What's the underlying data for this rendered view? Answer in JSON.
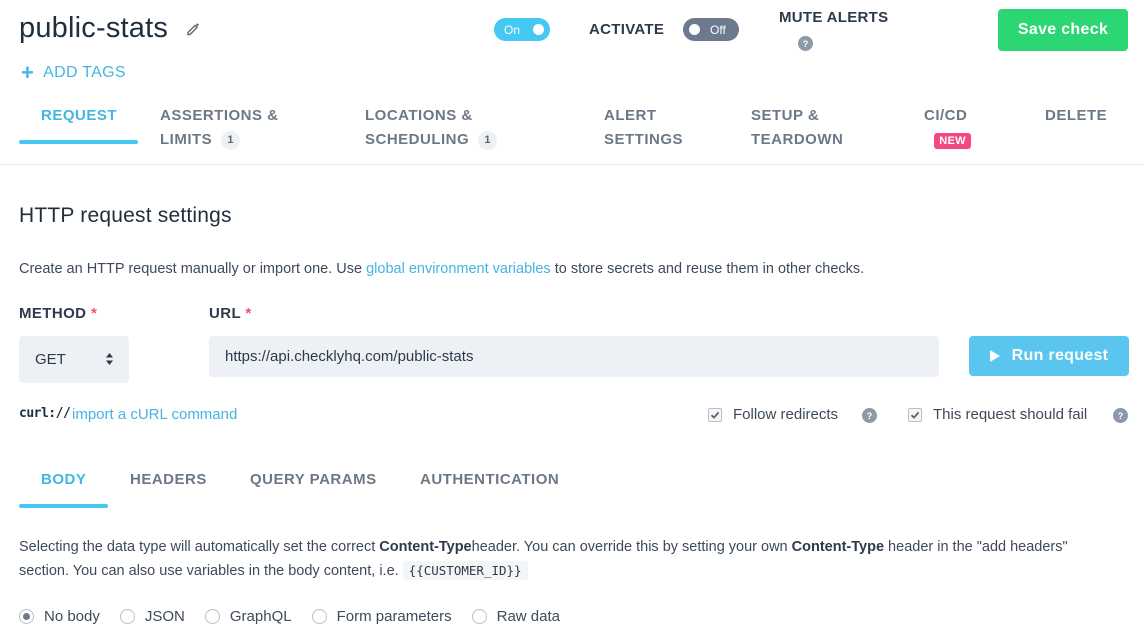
{
  "header": {
    "title": "public-stats",
    "toggle_on_label": "On",
    "activate_label": "ACTIVATE",
    "toggle_off_label": "Off",
    "mute_alerts_label": "MUTE ALERTS",
    "help_glyph": "?",
    "save_label": "Save check",
    "add_tags_label": "ADD TAGS",
    "add_tags_glyph": "+"
  },
  "tabs": [
    {
      "line1": "REQUEST",
      "line2": "",
      "count": ""
    },
    {
      "line1": "ASSERTIONS &",
      "line2": "LIMITS",
      "count": "1"
    },
    {
      "line1": "LOCATIONS &",
      "line2": "SCHEDULING",
      "count": "1"
    },
    {
      "line1": "ALERT",
      "line2": "SETTINGS",
      "count": ""
    },
    {
      "line1": "SETUP &",
      "line2": "TEARDOWN",
      "count": ""
    },
    {
      "line1": "CI/CD",
      "line2": "",
      "badge": "NEW"
    },
    {
      "line1": "DELETE",
      "line2": "",
      "count": ""
    }
  ],
  "request": {
    "section_title": "HTTP request settings",
    "desc_before": "Create an HTTP request manually or import one. Use ",
    "desc_link": "global environment variables",
    "desc_after": " to store secrets and reuse them in other checks.",
    "method_label": "METHOD",
    "url_label": "URL",
    "required_mark": "*",
    "method_value": "GET",
    "url_value": "https://api.checklyhq.com/public-stats",
    "run_label": "Run request",
    "curl_logo": "curl://",
    "curl_link": "import a cURL command",
    "follow_redirects_label": "Follow redirects",
    "follow_redirects_checked": true,
    "should_fail_label": "This request should fail",
    "should_fail_checked": true
  },
  "subtabs": [
    "BODY",
    "HEADERS",
    "QUERY PARAMS",
    "AUTHENTICATION"
  ],
  "body": {
    "desc_1": "Selecting the data type will automatically set the correct ",
    "desc_bold_1": "Content-Type",
    "desc_2": "header. You can override this by setting your own ",
    "desc_bold_2": "Content-Type",
    "desc_3": " header in the \"add headers\" section. You can also use variables in the body content, i.e.",
    "desc_code": "{{CUSTOMER_ID}}",
    "options": [
      "No body",
      "JSON",
      "GraphQL",
      "Form parameters",
      "Raw data"
    ],
    "selected": "No body"
  },
  "colors": {
    "accent": "#45c8f1",
    "link": "#45b5e3",
    "save_green": "#2bd673",
    "new_badge": "#f5487f"
  },
  "icons": {
    "edit": "pencil-icon",
    "help": "question-circle-icon",
    "play": "play-icon",
    "select": "chevron-up-down-icon",
    "check": "checkmark-icon"
  }
}
